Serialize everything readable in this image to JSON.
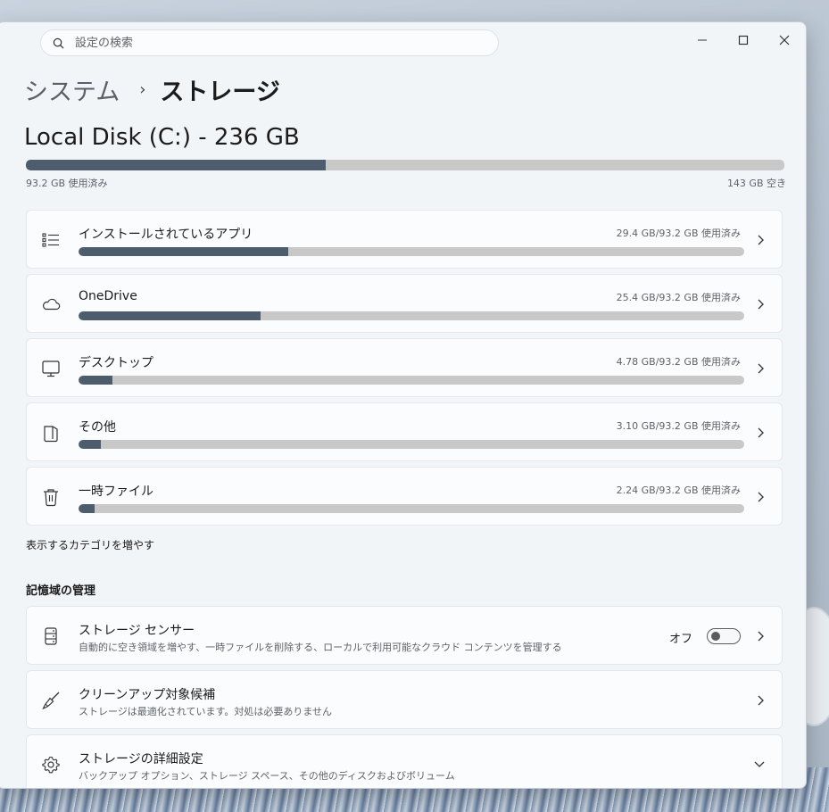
{
  "search": {
    "placeholder": "設定の検索"
  },
  "breadcrumb": {
    "parent": "システム",
    "separator": "›",
    "current": "ストレージ"
  },
  "disk": {
    "title": "Local Disk (C:) - 236 GB",
    "used_label": "93.2 GB 使用済み",
    "free_label": "143 GB 空き",
    "used_fraction": 0.395
  },
  "categories": [
    {
      "icon": "list-icon",
      "title": "インストールされているアプリ",
      "amount": "29.4 GB/93.2 GB 使用済み",
      "fraction": 0.315
    },
    {
      "icon": "cloud-icon",
      "title": "OneDrive",
      "amount": "25.4 GB/93.2 GB 使用済み",
      "fraction": 0.273
    },
    {
      "icon": "monitor-icon",
      "title": "デスクトップ",
      "amount": "4.78 GB/93.2 GB 使用済み",
      "fraction": 0.051
    },
    {
      "icon": "document-icon",
      "title": "その他",
      "amount": "3.10 GB/93.2 GB 使用済み",
      "fraction": 0.033
    },
    {
      "icon": "trash-icon",
      "title": "一時ファイル",
      "amount": "2.24 GB/93.2 GB 使用済み",
      "fraction": 0.024
    }
  ],
  "more_categories_link": "表示するカテゴリを増やす",
  "management": {
    "section_title": "記憶域の管理",
    "items": [
      {
        "icon": "drive-icon",
        "title": "ストレージ センサー",
        "desc": "自動的に空き領域を増やす、一時ファイルを削除する、ローカルで利用可能なクラウド コンテンツを管理する",
        "toggle_label": "オフ",
        "toggle_on": false
      },
      {
        "icon": "broom-icon",
        "title": "クリーンアップ対象候補",
        "desc": "ストレージは最適化されています。対処は必要ありません"
      },
      {
        "icon": "gear-icon",
        "title": "ストレージの詳細設定",
        "desc": "バックアップ オプション、ストレージ スペース、その他のディスクおよびボリューム"
      }
    ]
  },
  "colors": {
    "bar_fill": "#4d5d6d",
    "bar_track": "#c8c8c8",
    "background": "#f2f5f8"
  }
}
